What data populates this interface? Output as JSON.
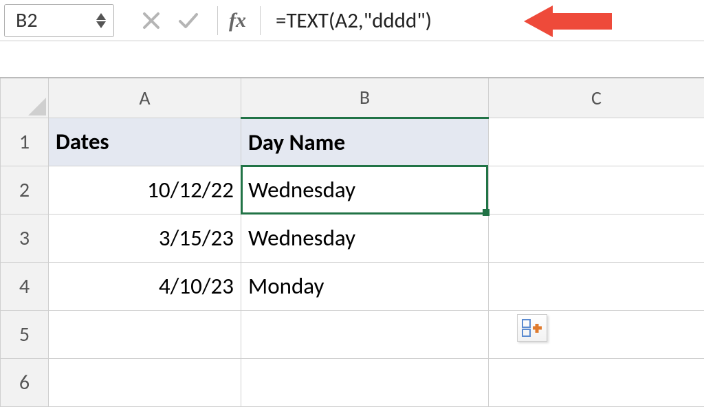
{
  "name_box": {
    "value": "B2"
  },
  "formula_bar": {
    "fx_label": "fx",
    "value": "=TEXT(A2,\"dddd\")"
  },
  "columns": {
    "a": "A",
    "b": "B",
    "c": "C"
  },
  "row_labels": [
    "1",
    "2",
    "3",
    "4",
    "5",
    "6"
  ],
  "headers": {
    "dates": "Dates",
    "dayname": "Day Name"
  },
  "rows": [
    {
      "date": "10/12/22",
      "day": "Wednesday"
    },
    {
      "date": "3/15/23",
      "day": "Wednesday"
    },
    {
      "date": "4/10/23",
      "day": "Monday"
    }
  ],
  "selected_cell": "B2",
  "colors": {
    "selection": "#217346",
    "arrow": "#ee4a3a",
    "header_fill": "#e4e8f1"
  }
}
